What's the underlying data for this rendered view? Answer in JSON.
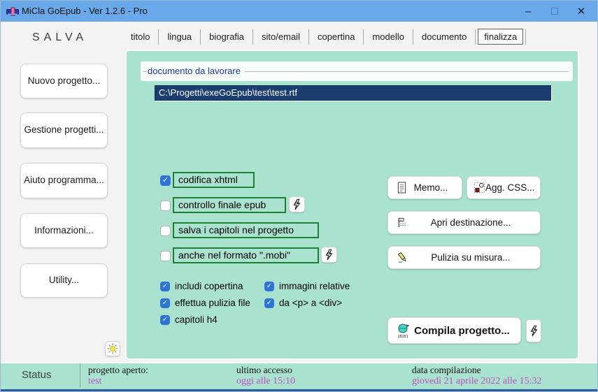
{
  "window": {
    "title": "MiCla GoEpub - Ver 1.2.6 - Pro",
    "controls": {
      "minimize": "–",
      "close": "✕"
    }
  },
  "sidebar": {
    "header": "SALVA",
    "buttons": [
      {
        "label": "Nuovo progetto..."
      },
      {
        "label": "Gestione progetti..."
      },
      {
        "label": "Aiuto programma..."
      },
      {
        "label": "Informazioni..."
      },
      {
        "label": "Utility..."
      }
    ]
  },
  "tabs": [
    {
      "label": "titolo",
      "selected": false
    },
    {
      "label": "lingua",
      "selected": false
    },
    {
      "label": "biografia",
      "selected": false
    },
    {
      "label": "sito/email",
      "selected": false
    },
    {
      "label": "copertina",
      "selected": false
    },
    {
      "label": "modello",
      "selected": false
    },
    {
      "label": "documento",
      "selected": false
    },
    {
      "label": "finalizza",
      "selected": true
    }
  ],
  "main": {
    "groupbox_label": "documento da lavorare",
    "document_path": "C:\\Progetti\\exeGoEpub\\test\\test.rtf",
    "option_rows": [
      {
        "label": "codifica xhtml",
        "checked": true,
        "bolt": false
      },
      {
        "label": "controllo finale epub",
        "checked": false,
        "bolt": true
      },
      {
        "label": "salva i capitoli nel progetto",
        "checked": false,
        "bolt": false
      },
      {
        "label": "anche nel formato \".mobi\"",
        "checked": false,
        "bolt": true
      }
    ],
    "checks": [
      {
        "label": "includi copertina",
        "checked": true
      },
      {
        "label": "effettua pulizia file",
        "checked": true
      },
      {
        "label": "capitoli h4",
        "checked": true
      },
      {
        "label": "immagini relative",
        "checked": true
      },
      {
        "label": "da <p> a <div>",
        "checked": true
      }
    ],
    "action_buttons": {
      "memo": "Memo...",
      "agg_css": "Agg. CSS...",
      "apri": "Apri destinazione...",
      "pulizia": "Pulizia su misura...",
      "compila": "Compila progetto..."
    },
    "icons": {
      "memo": "document-icon",
      "agg_css": "shapes-icon",
      "apri": "flag-tree-icon",
      "pulizia": "pencil-clean-icon",
      "compila": "globe-binary-icon",
      "bolt": "lightning-icon",
      "sun": "sun-icon"
    }
  },
  "statusbar": {
    "status_label": "Status",
    "panels": [
      {
        "label": "progetto aperto:",
        "value": "test"
      },
      {
        "label": "ultimo accesso",
        "value": "oggi alle 15:10"
      },
      {
        "label": "data compilazione",
        "value": "giovedì 21 aprile 2022 alle 15:32"
      }
    ]
  },
  "colors": {
    "titlebar_blue": "#69a9e9",
    "panel_teal": "#a9e2ce",
    "field_navy": "#1b3e70",
    "green_border": "#1e7e34",
    "checkbox_blue": "#2e74d6",
    "value_magenta": "#c24ec2"
  }
}
